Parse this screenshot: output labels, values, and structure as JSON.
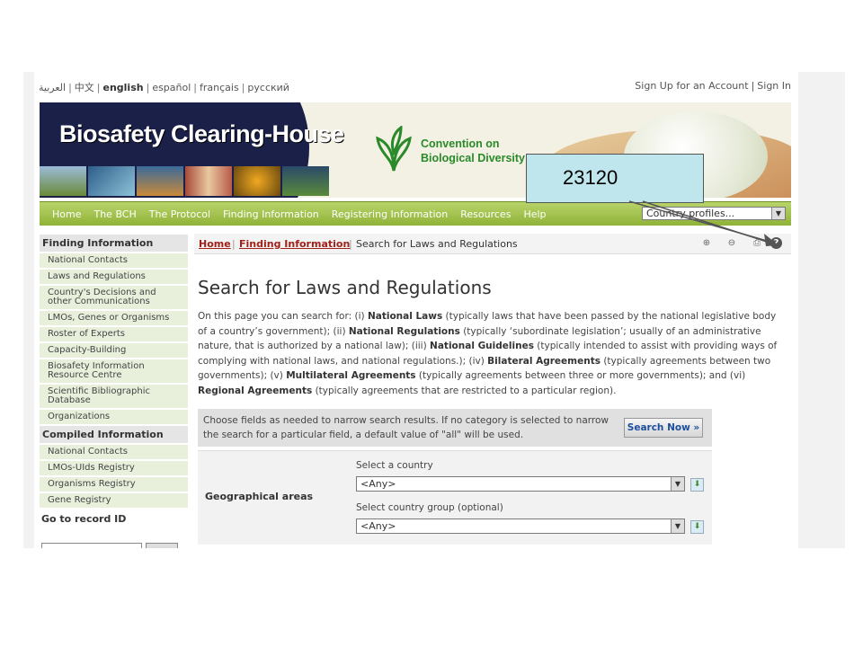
{
  "languages": [
    {
      "label": "العربية"
    },
    {
      "label": "中文"
    },
    {
      "label": "english"
    },
    {
      "label": "español"
    },
    {
      "label": "français"
    },
    {
      "label": "русский"
    }
  ],
  "account": {
    "signup": "Sign Up for an Account",
    "signin": "Sign In"
  },
  "banner": {
    "title": "Biosafety Clearing-House",
    "cbd_line1": "Convention on",
    "cbd_line2": "Biological Diversity"
  },
  "nav": {
    "items": [
      "Home",
      "The BCH",
      "The Protocol",
      "Finding Information",
      "Registering Information",
      "Resources",
      "Help"
    ],
    "select_value": "Country profiles..."
  },
  "sidebar": {
    "finding_header": "Finding Information",
    "finding_items": [
      "National Contacts",
      "Laws and Regulations",
      "Country's Decisions and other Communications",
      "LMOs, Genes or Organisms",
      "Roster of Experts",
      "Capacity-Building",
      "Biosafety Information Resource Centre",
      "Scientific Bibliographic Database",
      "Organizations"
    ],
    "compiled_header": "Compiled Information",
    "compiled_items": [
      "National Contacts",
      "LMOs-UIds Registry",
      "Organisms Registry",
      "Gene Registry"
    ],
    "record_label": "Go to record ID"
  },
  "breadcrumb": {
    "home": "Home",
    "finding": "Finding Information",
    "current": "Search for Laws and Regulations"
  },
  "main": {
    "title": "Search for Laws and Regulations",
    "intro": [
      {
        "t": "On this page you can search for: (i) ",
        "b": false
      },
      {
        "t": "National Laws",
        "b": true
      },
      {
        "t": " (typically laws that have been passed by the national legislative body of a country’s government); (ii) ",
        "b": false
      },
      {
        "t": "National Regulations",
        "b": true
      },
      {
        "t": " (typically ‘subordinate legislation’; usually of an administrative nature, that is authorized by a national law); (iii) ",
        "b": false
      },
      {
        "t": "National Guidelines",
        "b": true
      },
      {
        "t": " (typically intended to assist with providing ways of complying with national laws, and national regulations.); (iv) ",
        "b": false
      },
      {
        "t": "Bilateral Agreements",
        "b": true
      },
      {
        "t": " (typically agreements between two governments); (v) ",
        "b": false
      },
      {
        "t": "Multilateral Agreements",
        "b": true
      },
      {
        "t": " (typically agreements between three or more governments); and (vi) ",
        "b": false
      },
      {
        "t": "Regional Agreements",
        "b": true
      },
      {
        "t": " (typically agreements that are restricted to a particular region).",
        "b": false
      }
    ],
    "filter_text": "Choose fields as needed to narrow search results. If no category is selected to narrow the search for a particular field, a default value of \"all\" will be used.",
    "search_button": "Search Now »",
    "geo_label": "Geographical areas",
    "country_label": "Select a country",
    "country_value": "<Any>",
    "group_label": "Select country group (optional)",
    "group_value": "<Any>"
  },
  "callout": {
    "text": "23120"
  }
}
